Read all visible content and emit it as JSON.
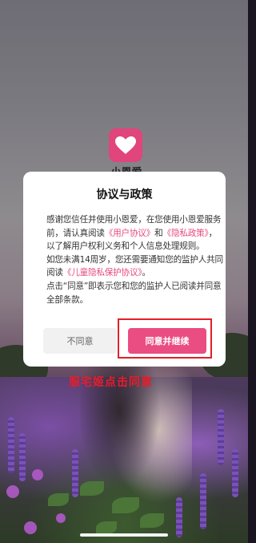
{
  "app": {
    "name": "小恩爱",
    "brand_color": "#e0457b"
  },
  "dialog": {
    "title": "协议与政策",
    "body": {
      "p1_a": "感谢您信任并使用小恩爱，在您使用小恩爱服务前，请认真阅读",
      "link_user_agreement": "《用户协议》",
      "p1_b": "和",
      "link_privacy": "《隐私政策》",
      "p1_c": "，以了解用户权利义务和个人信息处理规则。",
      "p2_a": "如您未满14周岁，您还需要通知您的监护人共同阅读",
      "link_child_privacy": "《儿童隐私保护协议》",
      "p2_b": "。",
      "p3": "点击“同意”即表示您和您的监护人已阅读并同意全部条款。"
    },
    "buttons": {
      "disagree": "不同意",
      "agree": "同意并继续"
    },
    "link_color": "#e64a80"
  },
  "annotation": {
    "text": "服宅姬点击同意",
    "color": "#e81d2a"
  }
}
